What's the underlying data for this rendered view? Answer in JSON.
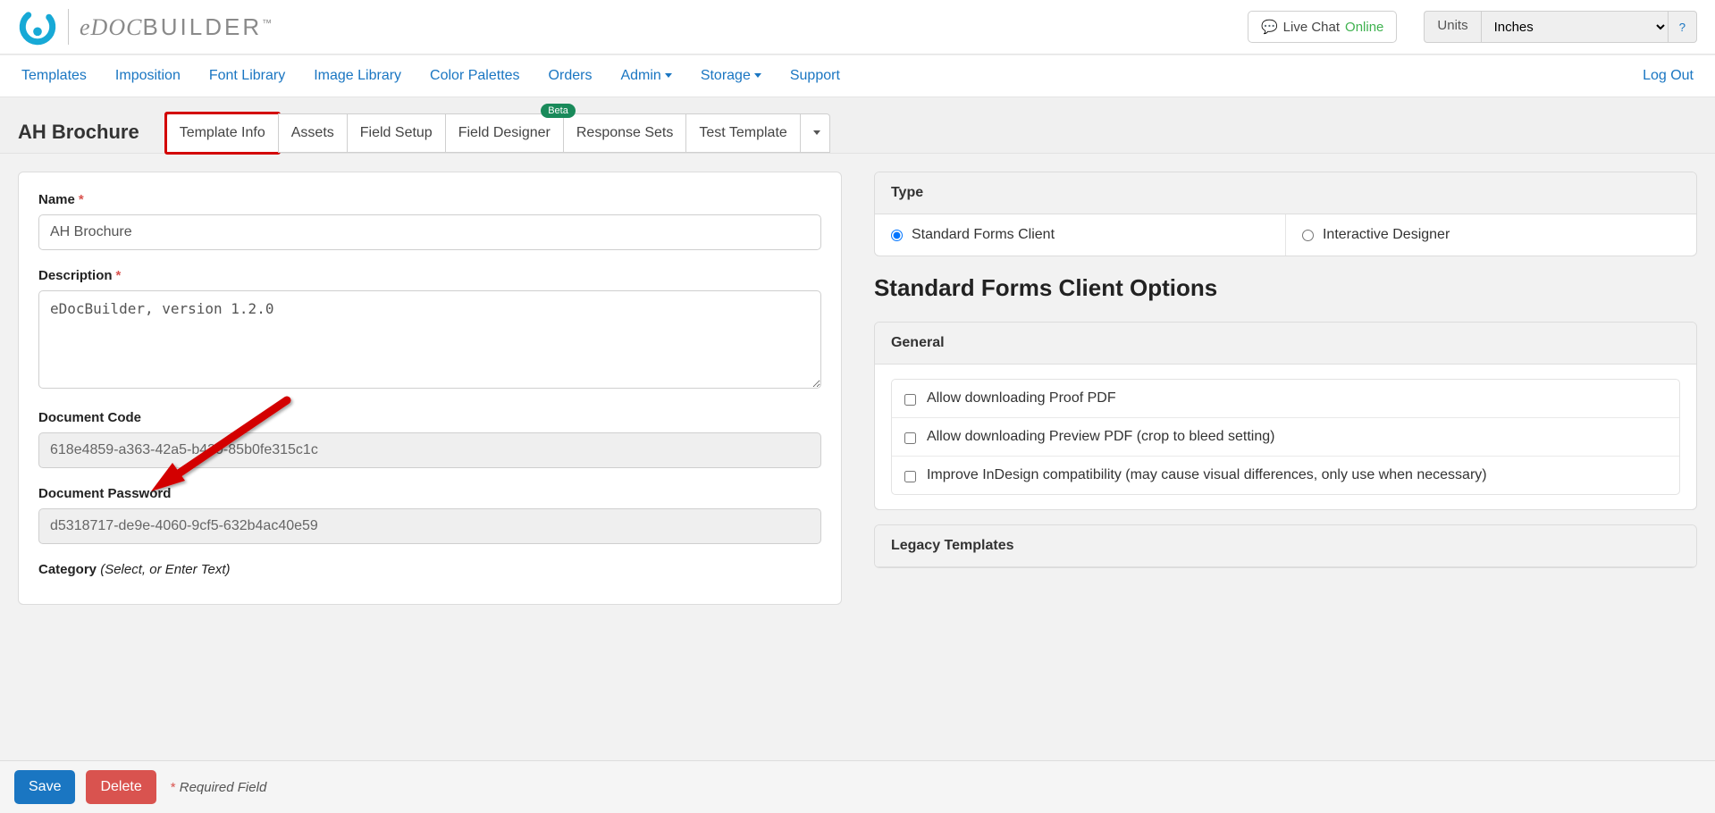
{
  "header": {
    "logo_text_edoc": "eDOC",
    "logo_text_builder": "BUILDER",
    "logo_tm": "™",
    "live_chat_label": "Live Chat",
    "live_chat_status": "Online",
    "units_label": "Units",
    "units_value": "Inches",
    "help_label": "?"
  },
  "nav": {
    "items": [
      "Templates",
      "Imposition",
      "Font Library",
      "Image Library",
      "Color Palettes",
      "Orders",
      "Admin",
      "Storage",
      "Support"
    ],
    "dropdown_indices": [
      6,
      7
    ],
    "logout_label": "Log Out"
  },
  "subbar": {
    "template_name": "AH Brochure",
    "tabs": [
      "Template Info",
      "Assets",
      "Field Setup",
      "Field Designer",
      "Response Sets",
      "Test Template"
    ],
    "beta_tab_index": 3,
    "beta_label": "Beta",
    "highlighted_tab_index": 0
  },
  "form": {
    "name_label": "Name",
    "name_value": "AH Brochure",
    "desc_label": "Description",
    "desc_value": "eDocBuilder, version 1.2.0",
    "doc_code_label": "Document Code",
    "doc_code_value": "618e4859-a363-42a5-b430-85b0fe315c1c",
    "doc_pass_label": "Document Password",
    "doc_pass_value": "d5318717-de9e-4060-9cf5-632b4ac40e59",
    "category_label": "Category",
    "category_hint": "(Select, or Enter Text)"
  },
  "type_panel": {
    "head": "Type",
    "options": [
      "Standard Forms Client",
      "Interactive Designer"
    ],
    "selected_index": 0
  },
  "options_section_title": "Standard Forms Client Options",
  "general_panel": {
    "head": "General",
    "checks": [
      "Allow downloading Proof PDF",
      "Allow downloading Preview PDF (crop to bleed setting)",
      "Improve InDesign compatibility (may cause visual differences, only use when necessary)"
    ]
  },
  "legacy_panel_head": "Legacy Templates",
  "footer": {
    "save_label": "Save",
    "delete_label": "Delete",
    "required_note_prefix": "*",
    "required_note_text": " Required Field"
  }
}
